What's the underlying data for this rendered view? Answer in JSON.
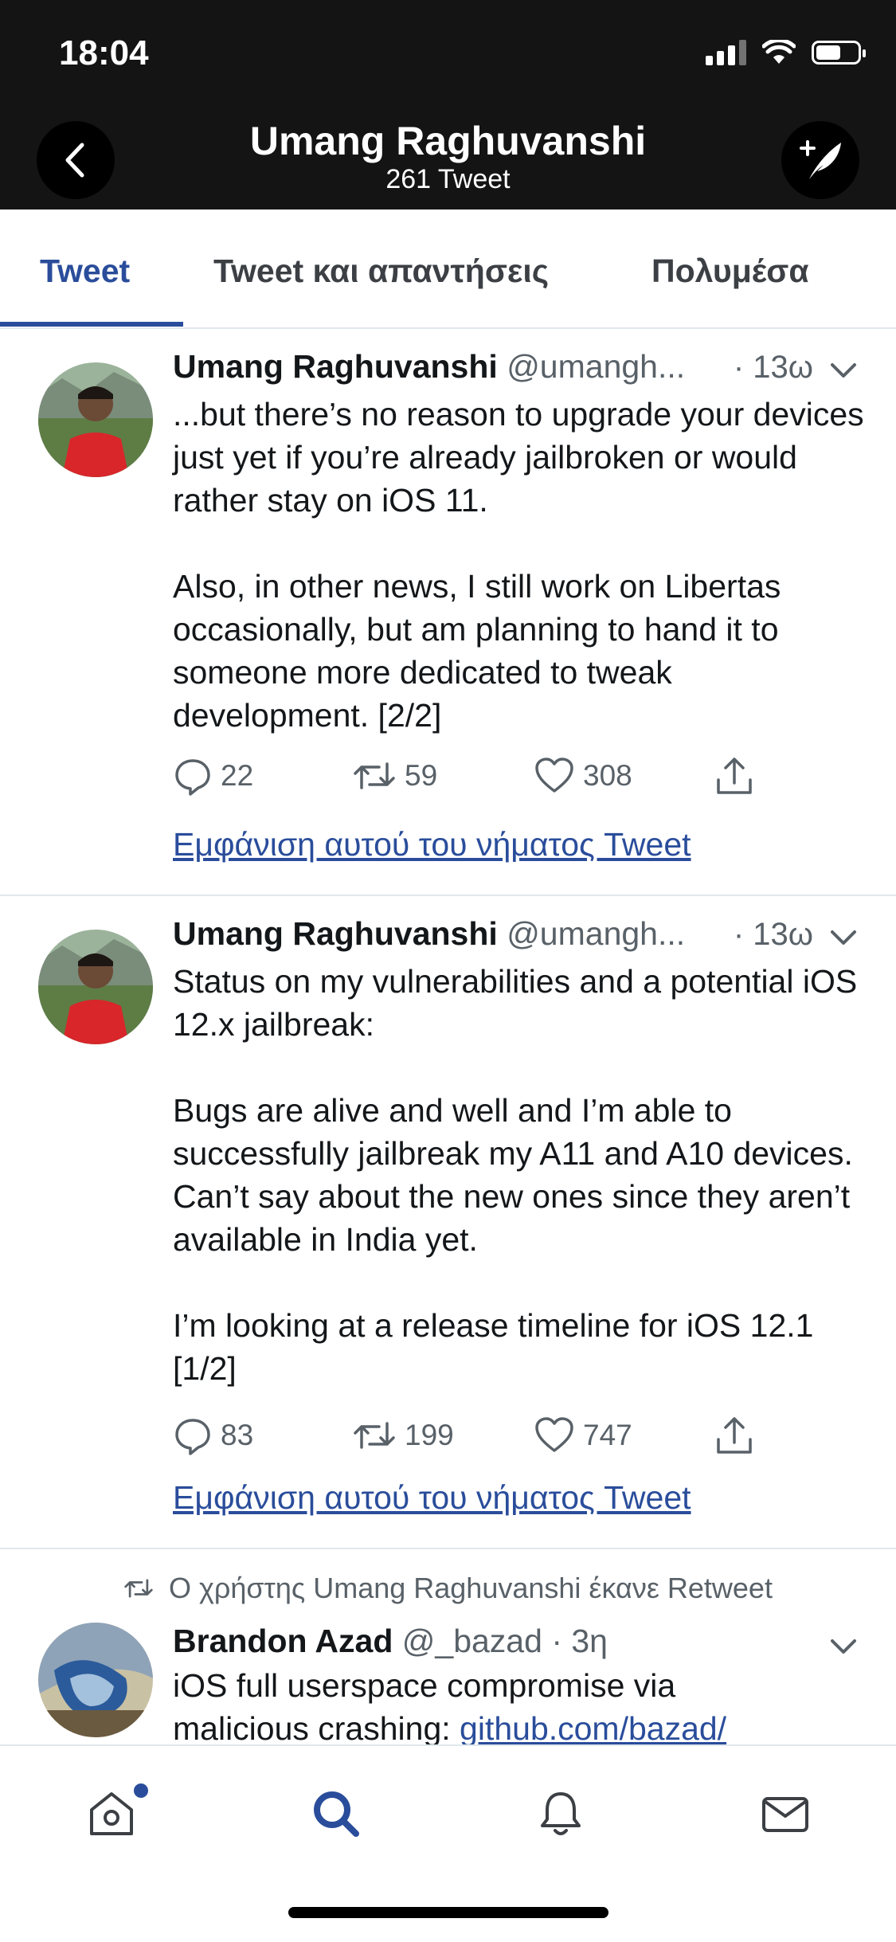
{
  "status_bar": {
    "time": "18:04"
  },
  "header": {
    "title": "Umang Raghuvanshi",
    "subtitle": "261 Tweet",
    "back_icon": "chevron-left-icon",
    "compose_icon": "compose-feather-icon"
  },
  "tabs": [
    {
      "label": "Tweet",
      "active": true
    },
    {
      "label": "Tweet και απαντήσεις",
      "active": false
    },
    {
      "label": "Πολυμέσα",
      "active": false
    }
  ],
  "tweets": [
    {
      "name": "Umang Raghuvanshi",
      "handle": "@umangh...",
      "time": "· 13ω",
      "text": "...but there’s no reason to upgrade your devices just yet if you’re already jailbroken or would rather stay on iOS 11.\n\nAlso, in other news, I still work on Libertas occasionally, but am planning to hand it to someone more dedicated to tweak development. [2/2]",
      "replies": "22",
      "retweets": "59",
      "likes": "308",
      "thread_link": "Εμφάνιση αυτού του νήματος Tweet"
    },
    {
      "name": "Umang Raghuvanshi",
      "handle": "@umangh...",
      "time": "· 13ω",
      "text": "Status on my vulnerabilities and a potential iOS 12.x jailbreak:\n\nBugs are alive and well and I’m able to successfully jailbreak my A11 and A10 devices. Can’t say about the new ones since they aren’t available in India yet.\n\nI’m looking at a release timeline for iOS 12.1 [1/2]",
      "replies": "83",
      "retweets": "199",
      "likes": "747",
      "thread_link": "Εμφάνιση αυτού του νήματος Tweet"
    },
    {
      "retweet_label": "Ο χρήστης Umang Raghuvanshi έκανε Retweet",
      "name": "Brandon Azad",
      "handle": "@_bazad",
      "time": "· 3η",
      "text_line1": "iOS full userspace compromise via",
      "text_line2_prefix": "malicious crashing: ",
      "text_link": "github.com/bazad/"
    }
  ],
  "bottom_nav": [
    {
      "icon": "home-icon",
      "active": false,
      "badge": true
    },
    {
      "icon": "search-icon",
      "active": true
    },
    {
      "icon": "bell-icon",
      "active": false
    },
    {
      "icon": "mail-icon",
      "active": false
    }
  ],
  "colors": {
    "accent": "#2a4d9b",
    "header_bg": "#141414",
    "secondary_text": "#596168"
  }
}
